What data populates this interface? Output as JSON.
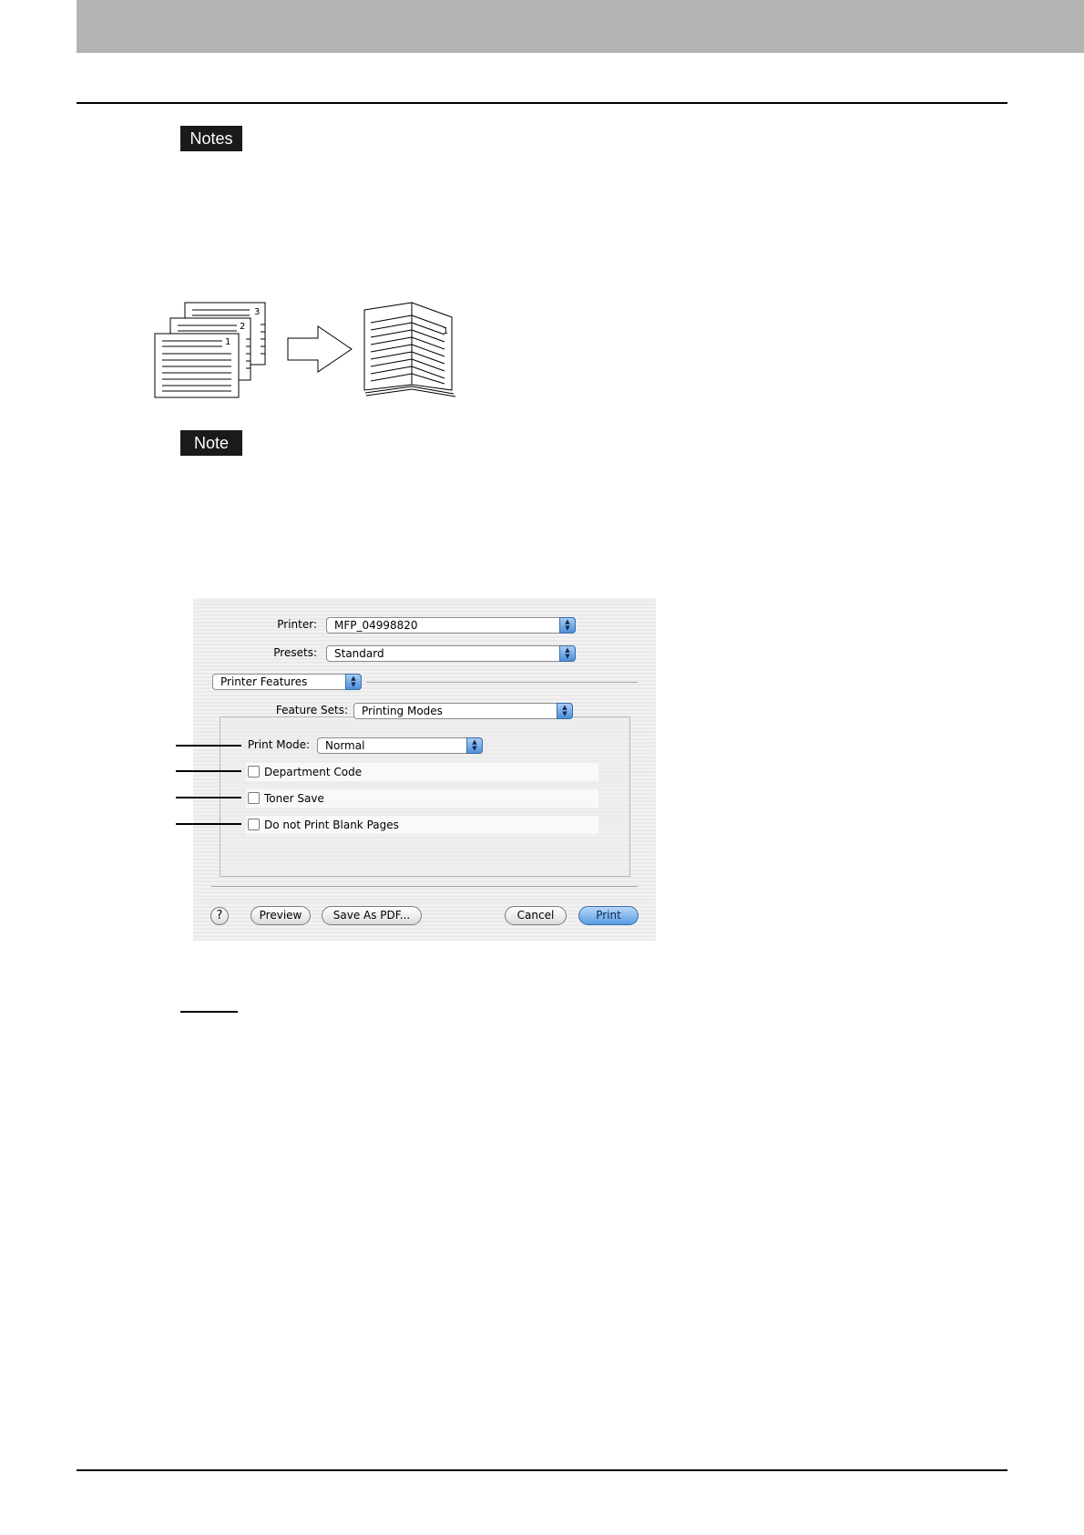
{
  "notes_label": "Notes",
  "note_label": "Note",
  "diagram": {
    "page_numbers": [
      "3",
      "2",
      "1"
    ],
    "result_page_number": "1"
  },
  "dialog": {
    "printer_label": "Printer:",
    "printer_value": "MFP_04998820",
    "presets_label": "Presets:",
    "presets_value": "Standard",
    "panel_value": "Printer Features",
    "feature_sets_label": "Feature Sets:",
    "feature_sets_value": "Printing Modes",
    "print_mode_label": "Print Mode:",
    "print_mode_value": "Normal",
    "checkboxes": [
      {
        "label": "Department Code",
        "checked": false
      },
      {
        "label": "Toner Save",
        "checked": false
      },
      {
        "label": "Do not Print Blank Pages",
        "checked": false
      }
    ],
    "help_label": "?",
    "preview_label": "Preview",
    "save_pdf_label": "Save As PDF...",
    "cancel_label": "Cancel",
    "print_label": "Print"
  },
  "colors": {
    "header_bar": "#b3b3b3",
    "label_box": "#1a1a1a",
    "aqua_button": "#5a9be4"
  }
}
